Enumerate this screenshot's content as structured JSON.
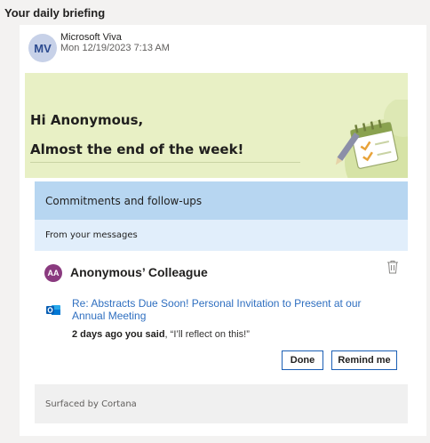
{
  "header": {
    "title": "Your daily briefing"
  },
  "message": {
    "avatar_initials": "MV",
    "sender": "Microsoft Viva",
    "datetime": "Mon 12/19/2023 7:13 AM"
  },
  "hero": {
    "greeting": "Hi Anonymous,",
    "subtitle": "Almost the end of the week!"
  },
  "commitments": {
    "title": "Commitments and follow-ups",
    "section": "From your messages",
    "item": {
      "avatar_initials": "AA",
      "person": "Anonymous’ Colleague",
      "email_subject": "Re: Abstracts Due Soon! Personal Invitation to Present at our Annual Meeting",
      "when": "2 days ago you said",
      "quote": ", “I’ll reflect on this!”",
      "done_label": "Done",
      "remind_label": "Remind me"
    },
    "footer": "Surfaced by Cortana"
  },
  "colors": {
    "hero_bg": "#e8f0c5",
    "section_header_bg": "#b7d6f1",
    "subsection_bg": "#e1eefb",
    "link": "#2f6fc0",
    "button_border": "#1b5fb5"
  },
  "icons": [
    "trash-icon",
    "outlook-icon",
    "calendar-illustration"
  ]
}
